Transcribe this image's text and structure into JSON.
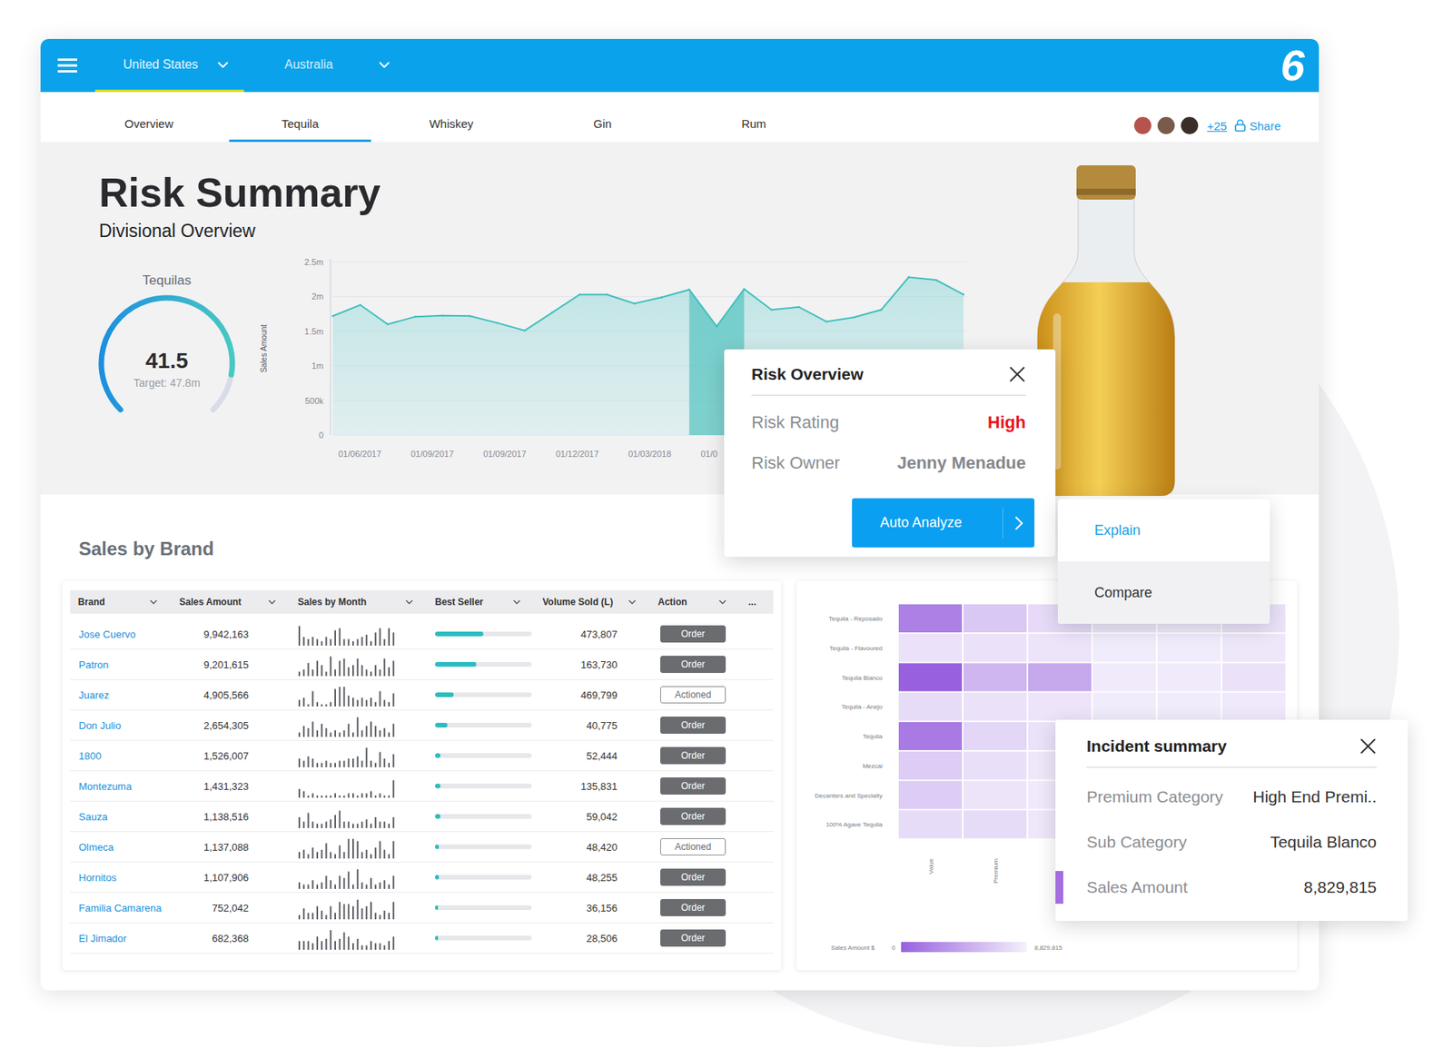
{
  "top_bar": {
    "regions": [
      {
        "label": "United States",
        "selected": true
      },
      {
        "label": "Australia",
        "selected": false
      }
    ],
    "logo": "6"
  },
  "tabs": [
    {
      "label": "Overview",
      "selected": false
    },
    {
      "label": "Tequila",
      "selected": true
    },
    {
      "label": "Whiskey",
      "selected": false
    },
    {
      "label": "Gin",
      "selected": false
    },
    {
      "label": "Rum",
      "selected": false
    }
  ],
  "collaborators": {
    "avatars": [
      {
        "color": "#b5534c"
      },
      {
        "color": "#7a5a4a"
      },
      {
        "color": "#3b2d27"
      }
    ],
    "more": "+25",
    "share": "Share"
  },
  "hero": {
    "title": "Risk Summary",
    "subtitle": "Divisional Overview"
  },
  "gauge": {
    "label": "Tequilas",
    "value": "41.5",
    "target": "Target: 47.8m",
    "level": 0.87
  },
  "trend_chart": {
    "axis_title": "Sales Amount",
    "max": 2500000,
    "y_ticks": [
      {
        "label": "2.5m",
        "value": 2500000
      },
      {
        "label": "2m",
        "value": 2000000
      },
      {
        "label": "1.5m",
        "value": 1500000
      },
      {
        "label": "1m",
        "value": 1000000
      },
      {
        "label": "500k",
        "value": 500000
      },
      {
        "label": "0",
        "value": 0
      }
    ],
    "x_labels": [
      "01/06/2017",
      "01/09/2017",
      "01/09/2017",
      "01/12/2017",
      "01/03/2018",
      "01/0"
    ],
    "series": [
      1720000,
      1880000,
      1600000,
      1710000,
      1725000,
      1720000,
      1620000,
      1510000,
      1770000,
      2030000,
      2030000,
      1900000,
      1990000,
      2100000,
      1570000,
      2110000,
      1810000,
      1850000,
      1640000,
      1700000,
      1810000,
      2280000,
      2240000,
      2030000
    ],
    "highlight": {
      "from": 13,
      "to": 15
    }
  },
  "sales_by_brand": {
    "title": "Sales by Brand",
    "columns": [
      {
        "label": "Brand",
        "sortable": true
      },
      {
        "label": "Sales Amount",
        "sortable": true
      },
      {
        "label": "Sales by Month",
        "sortable": true
      },
      {
        "label": "Best Seller",
        "sortable": true
      },
      {
        "label": "Volume Sold (L)",
        "sortable": true
      },
      {
        "label": "Action",
        "sortable": true
      },
      {
        "label": "...",
        "sortable": false
      }
    ],
    "rows": [
      {
        "brand": "Jose Cuervo",
        "sales": "9,942,163",
        "monthly": [
          9,
          4,
          3,
          4,
          3,
          2,
          4,
          3,
          7,
          8,
          3,
          3,
          2,
          3,
          4,
          5,
          2,
          6,
          8,
          3,
          8,
          6
        ],
        "best_seller_level": 0.5,
        "volume": "473,807",
        "action": "Order",
        "actioned": false
      },
      {
        "brand": "Patron",
        "sales": "9,201,615",
        "monthly": [
          2,
          3,
          6,
          3,
          7,
          5,
          2,
          9,
          3,
          7,
          8,
          4,
          5,
          8,
          5,
          3,
          2,
          5,
          3,
          8,
          4,
          7
        ],
        "best_seller_level": 0.43,
        "volume": "163,730",
        "action": "Order",
        "actioned": false
      },
      {
        "brand": "Juarez",
        "sales": "4,905,566",
        "monthly": [
          3,
          4,
          1,
          7,
          2,
          1,
          1,
          2,
          8,
          9,
          9,
          5,
          4,
          3,
          4,
          3,
          4,
          2,
          7,
          3,
          2,
          6
        ],
        "best_seller_level": 0.19,
        "volume": "469,799",
        "action": "Actioned",
        "actioned": true
      },
      {
        "brand": "Don Julio",
        "sales": "2,654,305",
        "monthly": [
          2,
          5,
          4,
          7,
          3,
          6,
          4,
          2,
          3,
          2,
          3,
          6,
          2,
          9,
          3,
          5,
          7,
          5,
          3,
          4,
          2,
          6
        ],
        "best_seller_level": 0.13,
        "volume": "40,775",
        "action": "Order",
        "actioned": false
      },
      {
        "brand": "1800",
        "sales": "1,526,007",
        "monthly": [
          4,
          3,
          5,
          4,
          2,
          2,
          3,
          2,
          2,
          3,
          3,
          4,
          4,
          5,
          3,
          9,
          3,
          2,
          7,
          4,
          2,
          6
        ],
        "best_seller_level": 0.06,
        "volume": "52,444",
        "action": "Order",
        "actioned": false
      },
      {
        "brand": "Montezuma",
        "sales": "1,431,323",
        "monthly": [
          4,
          3,
          1,
          2,
          1,
          1,
          1,
          1,
          2,
          1,
          1,
          2,
          2,
          1,
          2,
          2,
          3,
          1,
          2,
          1,
          1,
          8
        ],
        "best_seller_level": 0.06,
        "volume": "135,831",
        "action": "Order",
        "actioned": false
      },
      {
        "brand": "Sauza",
        "sales": "1,138,516",
        "monthly": [
          5,
          3,
          7,
          3,
          2,
          2,
          3,
          4,
          6,
          8,
          3,
          3,
          2,
          2,
          3,
          4,
          2,
          5,
          3,
          3,
          2,
          5
        ],
        "best_seller_level": 0.06,
        "volume": "59,042",
        "action": "Order",
        "actioned": false
      },
      {
        "brand": "Olmeca",
        "sales": "1,137,088",
        "monthly": [
          3,
          4,
          2,
          5,
          3,
          4,
          7,
          3,
          2,
          6,
          3,
          9,
          9,
          8,
          3,
          4,
          2,
          5,
          8,
          4,
          2,
          8
        ],
        "best_seller_level": 0.04,
        "volume": "48,420",
        "action": "Actioned",
        "actioned": true
      },
      {
        "brand": "Hornitos",
        "sales": "1,107,906",
        "monthly": [
          3,
          2,
          2,
          4,
          2,
          3,
          6,
          4,
          2,
          6,
          5,
          8,
          2,
          9,
          3,
          2,
          5,
          2,
          3,
          4,
          2,
          6
        ],
        "best_seller_level": 0.04,
        "volume": "48,255",
        "action": "Order",
        "actioned": false
      },
      {
        "brand": "Familia Camarena",
        "sales": "752,042",
        "monthly": [
          2,
          5,
          3,
          3,
          6,
          4,
          2,
          6,
          3,
          8,
          7,
          7,
          6,
          9,
          5,
          6,
          8,
          3,
          2,
          4,
          3,
          8
        ],
        "best_seller_level": 0.03,
        "volume": "36,156",
        "action": "Order",
        "actioned": false
      },
      {
        "brand": "El Jimador",
        "sales": "682,368",
        "monthly": [
          4,
          4,
          4,
          3,
          6,
          4,
          5,
          9,
          4,
          5,
          8,
          6,
          3,
          5,
          2,
          2,
          4,
          3,
          3,
          2,
          4,
          6
        ],
        "best_seller_level": 0.03,
        "volume": "28,506",
        "action": "Order",
        "actioned": false
      }
    ]
  },
  "heatmap": {
    "scale_max": 8829815,
    "rows": [
      {
        "label": "Tequila - Reposado",
        "values": [
          6887000,
          2472000,
          1324000,
          530000,
          353000,
          883000
        ]
      },
      {
        "label": "Tequila - Flavoured",
        "values": [
          883000,
          883000,
          706000,
          265000,
          265000,
          530000
        ]
      },
      {
        "label": "Tequila Blanco",
        "values": [
          8829815,
          3532000,
          4415000,
          353000,
          353000,
          883000
        ]
      },
      {
        "label": "Tequila - Anejo",
        "values": [
          1236000,
          883000,
          706000,
          265000,
          265000,
          441000
        ]
      },
      {
        "label": "Tequila",
        "values": [
          7240000,
          1589000,
          883000,
          353000,
          265000,
          441000
        ]
      },
      {
        "label": "Mezcal",
        "values": [
          2207000,
          1060000,
          530000,
          265000,
          265000,
          353000
        ]
      },
      {
        "label": "Decanters and Specialty",
        "values": [
          2207000,
          706000,
          441000,
          265000,
          177000,
          353000
        ]
      },
      {
        "label": "100% Agave Tequila",
        "values": [
          1236000,
          1236000,
          530000,
          265000,
          177000,
          353000
        ]
      }
    ],
    "column_labels": [
      "Value",
      "Premium"
    ],
    "legend": {
      "title": "Sales Amount $",
      "min": "0",
      "max": "8,829,815"
    }
  },
  "risk_overview": {
    "title": "Risk Overview",
    "fields": [
      {
        "label": "Risk Rating",
        "value": "High",
        "alert": true
      },
      {
        "label": "Risk Owner",
        "value": "Jenny Menadue",
        "alert": false
      }
    ],
    "button": "Auto Analyze"
  },
  "analyze_menu": {
    "items": [
      {
        "label": "Explain",
        "selected": true,
        "hovered": false
      },
      {
        "label": "Compare",
        "selected": false,
        "hovered": true
      }
    ]
  },
  "incident_summary": {
    "title": "Incident summary",
    "fields": [
      {
        "label": "Premium Category",
        "value": "High End Premi..",
        "marked": false
      },
      {
        "label": "Sub Category",
        "value": "Tequila Blanco",
        "marked": false
      },
      {
        "label": "Sales Amount",
        "value": "8,829,815",
        "marked": true
      }
    ]
  }
}
